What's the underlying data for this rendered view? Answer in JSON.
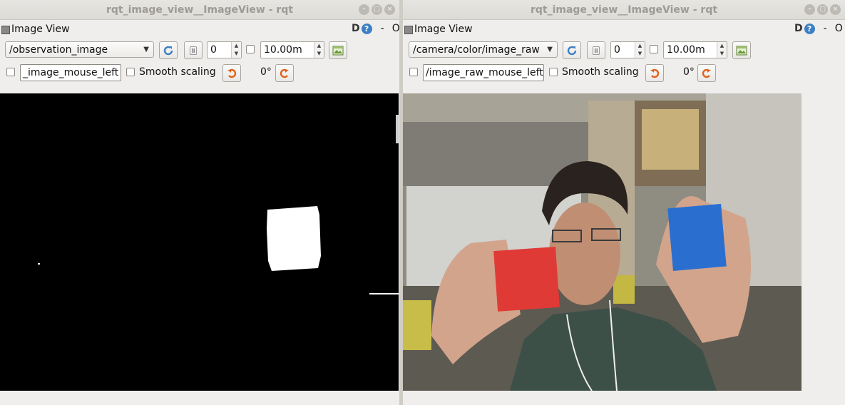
{
  "left": {
    "title": "rqt_image_view__ImageView - rqt",
    "plugin_title": "Image View",
    "d_label": "D",
    "help_label": "?",
    "dash_label": "-",
    "o_label": "O",
    "topic": "/observation_image",
    "spin_value": "0",
    "max_rate": "10.00m",
    "mouse_topic": "_image_mouse_left",
    "smooth_label": "Smooth scaling",
    "rotation": "0°"
  },
  "right": {
    "title": "rqt_image_view__ImageView - rqt",
    "plugin_title": "Image View",
    "d_label": "D",
    "help_label": "?",
    "dash_label": "-",
    "o_label": "O",
    "topic": "/camera/color/image_raw",
    "spin_value": "0",
    "max_rate": "10.00m",
    "mouse_topic": "/image_raw_mouse_left",
    "smooth_label": "Smooth scaling",
    "rotation": "0°"
  },
  "window_buttons": {
    "minimize": "–",
    "maximize": "□",
    "close": "×"
  },
  "icons": [
    "refresh-icon",
    "pause-icon",
    "save-image-icon",
    "rotate-left-icon",
    "rotate-right-icon",
    "plugin-icon",
    "help-icon"
  ],
  "colors": {
    "accent_blue": "#3c7fc4",
    "rotate_orange": "#e0621a",
    "mask_white": "#ffffff",
    "mask_bg": "#000000",
    "red_block": "#e03a36",
    "blue_block": "#2a6fd0"
  }
}
